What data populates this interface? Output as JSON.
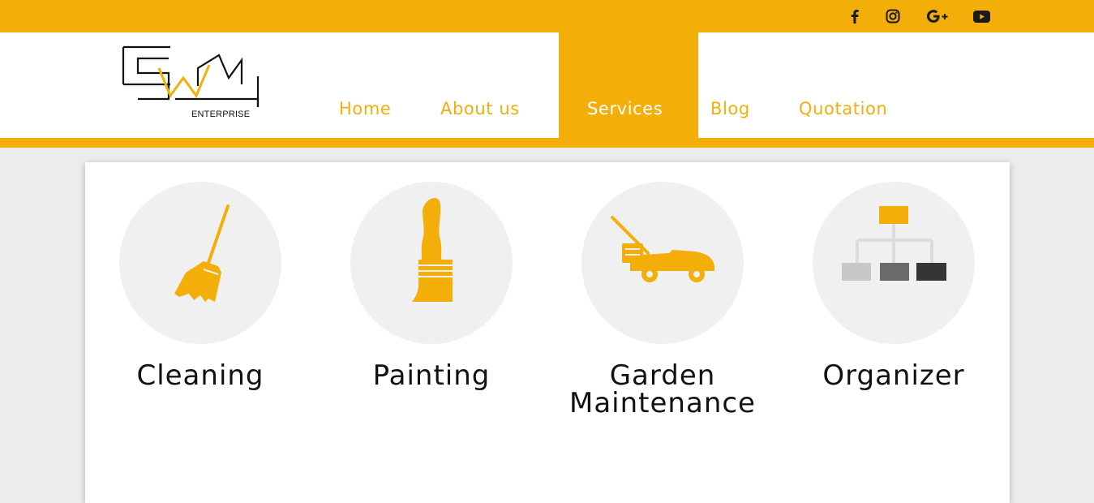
{
  "social": [
    {
      "name": "facebook-icon"
    },
    {
      "name": "instagram-icon"
    },
    {
      "name": "google-plus-icon"
    },
    {
      "name": "youtube-icon"
    }
  ],
  "logo": {
    "letters": "SWM",
    "subtitle": "ENTERPRISE"
  },
  "nav": {
    "home": "Home",
    "about": "About us",
    "services": "Services",
    "blog": "Blog",
    "quotation": "Quotation",
    "active": "Services"
  },
  "services": [
    {
      "label": "Cleaning",
      "icon": "broom-icon"
    },
    {
      "label": "Painting",
      "icon": "paintbrush-icon"
    },
    {
      "label": "Garden Maintenance",
      "icon": "lawn-mower-icon"
    },
    {
      "label": "Organizer",
      "icon": "org-chart-icon"
    }
  ],
  "colors": {
    "accent": "#f3ae0a",
    "background": "#ececec",
    "text": "#111111"
  }
}
